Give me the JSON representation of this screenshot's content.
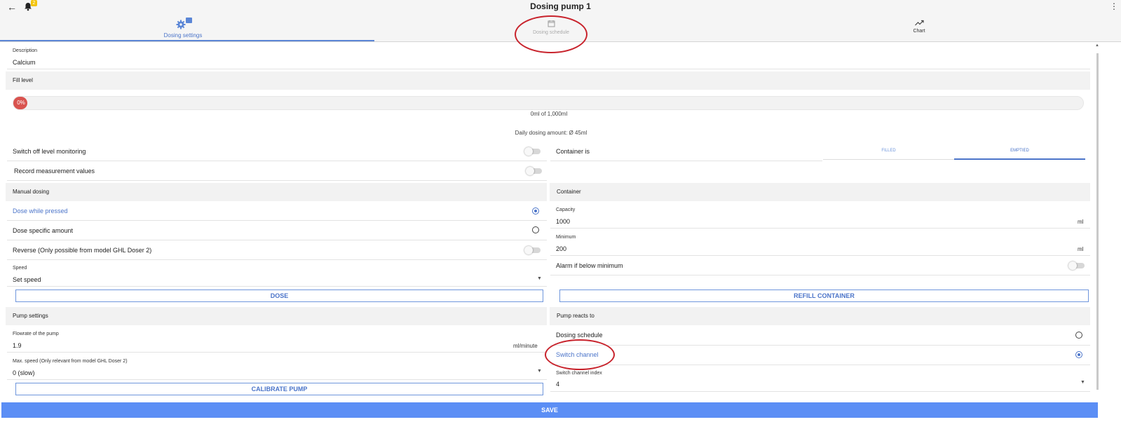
{
  "header": {
    "title": "Dosing pump 1",
    "notification_count": "2",
    "tabs": [
      {
        "label": "Dosing settings",
        "icon": "gear-icon"
      },
      {
        "label": "Dosing schedule",
        "icon": "calendar-icon"
      },
      {
        "label": "Chart",
        "icon": "trend-icon"
      }
    ]
  },
  "description": {
    "label": "Description",
    "value": "Calcium"
  },
  "fill_level": {
    "section": "Fill level",
    "percent_label": "0%",
    "fill_fraction": 0,
    "amount_text": "0ml of 1,000ml",
    "daily_text": "Daily dosing amount: Ø 45ml"
  },
  "monitoring": {
    "switch_off_label": "Switch off level monitoring",
    "record_label": "Record measurement values",
    "container_is_label": "Container is",
    "filled_label": "FILLED",
    "emptied_label": "EMPTIED"
  },
  "manual_dosing": {
    "section": "Manual dosing",
    "dose_while_pressed": "Dose while pressed",
    "dose_specific": "Dose specific amount",
    "reverse": "Reverse (Only possible from model GHL Doser 2)",
    "speed_label": "Speed",
    "speed_value": "Set speed",
    "dose_button": "DOSE"
  },
  "container": {
    "section": "Container",
    "capacity_label": "Capacity",
    "capacity_value": "1000",
    "capacity_unit": "ml",
    "minimum_label": "Minimum",
    "minimum_value": "200",
    "minimum_unit": "ml",
    "alarm_label": "Alarm if below minimum",
    "refill_button": "REFILL CONTAINER"
  },
  "pump_settings": {
    "section": "Pump settings",
    "flowrate_label": "Flowrate of the pump",
    "flowrate_value": "1.9",
    "flowrate_unit": "ml/minute",
    "maxspeed_label": "Max. speed (Only relevant from model GHL Doser 2)",
    "maxspeed_value": "0 (slow)",
    "calibrate_button": "CALIBRATE PUMP"
  },
  "pump_reacts": {
    "section": "Pump reacts to",
    "dosing_schedule": "Dosing schedule",
    "switch_channel": "Switch channel",
    "index_label": "Switch channel index",
    "index_value": "4"
  },
  "save_label": "SAVE",
  "colors": {
    "accent": "#4b74c9",
    "save_bar": "#5b8ef5",
    "annotation": "#c8232c",
    "badge": "#f3c40b"
  }
}
